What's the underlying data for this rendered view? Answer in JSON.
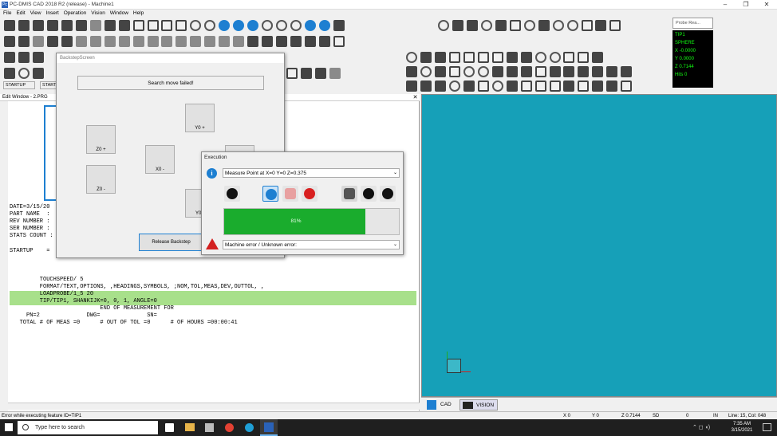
{
  "window": {
    "title": "PC-DMIS CAD 2018 R2 (release) - Machine1",
    "app_icon": "Pc"
  },
  "menu": [
    "File",
    "Edit",
    "View",
    "Insert",
    "Operation",
    "Vision",
    "Window",
    "Help"
  ],
  "toolbar_labels": {
    "startup_tab": "STARTUP",
    "start_tab": "START"
  },
  "probe_readout": {
    "title": "Probe Rea...",
    "lines": [
      "TIP1",
      "SPHERE",
      "X  -0.0000",
      "Y   0.0000",
      "Z   0.7144",
      "Hits     0"
    ]
  },
  "edit_window": {
    "title": "Edit Window - 2.PRG",
    "header_lines": [
      "DATE=3/15/20",
      "PART NAME  :",
      "REV NUMBER :",
      "SER NUMBER :",
      "STATS COUNT :"
    ],
    "startup_label": "STARTUP    =",
    "code_lines": [
      "         TOUCHSPEED/ 5",
      "         FORMAT/TEXT,OPTIONS, ,HEADINGS,SYMBOLS, ;NOM,TOL,MEAS,DEV,OUTTOL, ,",
      "         LOADPROBE/1_5 20",
      "         TIP/TIP1, SHANKIJK=0, 0, 1, ANGLE=0",
      "                           END OF MEASUREMENT FOR",
      "     PN=2              DWG=              SN=",
      "   TOTAL # OF MEAS =0      # OUT OF TOL =0      # OF HOURS =00:00:41"
    ]
  },
  "backstep": {
    "title": "BackstepScreen",
    "message": "Search move failed!",
    "buttons": {
      "yplus": "Y0 +",
      "zplus": "Z0 +",
      "xminus": "X0 -",
      "zminus": "Z0 -",
      "yminus": "Y0 -",
      "release": "Release Backstep"
    }
  },
  "execution": {
    "title": "Execution",
    "command": "Measure Point at X=0 Y=0 Z=0.375",
    "progress_label": "81%",
    "progress": 0.81,
    "error": "Machine error / Unknown error:"
  },
  "viewport_tabs": {
    "cad": "CAD",
    "vision": "VISION"
  },
  "statusbar": {
    "message": "Error while executing feature ID=TIP1",
    "x": "X  0",
    "y": "Y  0",
    "z": "Z  0.7144",
    "sd": "SD",
    "sdval": "0",
    "in": "IN",
    "line": "Line: 15, Col: 048"
  },
  "taskbar": {
    "search": "Type here to search",
    "time": "7:35 AM",
    "date": "3/15/2021"
  },
  "colors": {
    "viewport": "#16a0b8",
    "highlight": "#a8e08b",
    "progress": "#1aac2d",
    "accent": "#1d7fd1"
  }
}
